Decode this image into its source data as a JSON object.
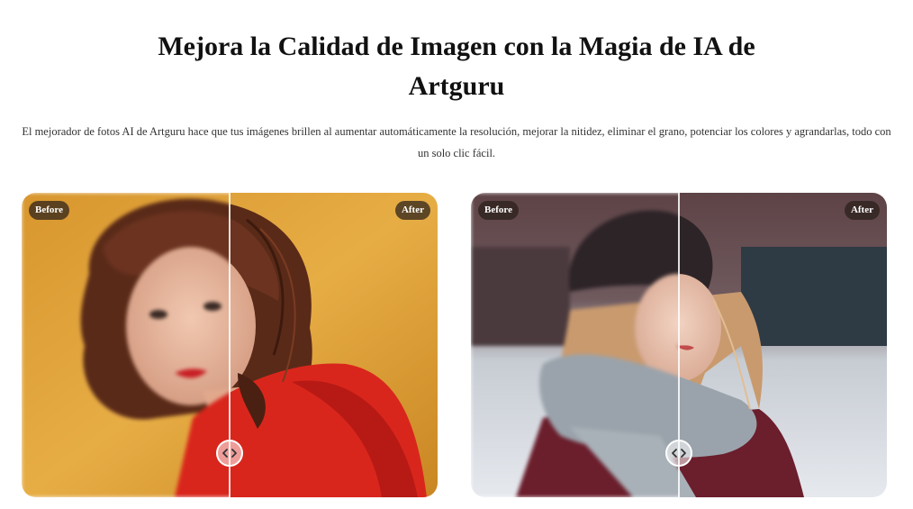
{
  "header": {
    "title_line1": "Mejora la Calidad de Imagen con la Magia de IA de",
    "title_line2": "Artguru",
    "description": "El mejorador de fotos AI de Artguru hace que tus imágenes brillen al aumentar automáticamente la resolución, mejorar la nitidez, eliminar el grano, potenciar los colores y agrandarlas, todo con un solo clic fácil."
  },
  "comparisons": [
    {
      "before_label": "Before",
      "after_label": "After",
      "slider_position": 0.5,
      "handle_icon": "chevron-left-right-icon"
    },
    {
      "before_label": "Before",
      "after_label": "After",
      "slider_position": 0.5,
      "handle_icon": "chevron-left-right-icon"
    }
  ],
  "colors": {
    "title": "#111111",
    "text": "#333333",
    "tag_bg": "#2a1f1a",
    "card1_bg": "#e2a434",
    "card1_shirt": "#d9261c",
    "card2_bg": "#d7dce2",
    "card2_scarf": "#9aa3ab"
  }
}
